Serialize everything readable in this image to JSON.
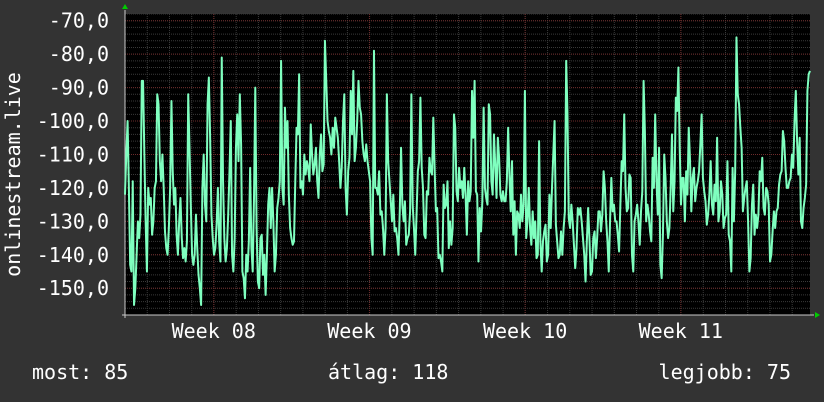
{
  "colors": {
    "background": "#333333",
    "plot_bg": "#000000",
    "line": "#7fffbf",
    "grid_major": "#6e2b2b",
    "grid_minor": "#3a3a3a",
    "axis": "#c8c8c8",
    "arrow": "#00cc00",
    "text": "#ffffff"
  },
  "chart_data": {
    "type": "line",
    "ylabel": "onlinestream.live",
    "ylim": [
      -158,
      -68
    ],
    "yticks": [
      -70,
      -80,
      -90,
      -100,
      -110,
      -120,
      -130,
      -140,
      -150
    ],
    "ytick_labels": [
      "-70,0",
      "-80,0",
      "-90,0",
      "-100,0",
      "-110,0",
      "-120,0",
      "-130,0",
      "-140,0",
      "-150,0"
    ],
    "xlim": [
      0,
      4.4
    ],
    "xticks": [
      0.57,
      1.57,
      2.57,
      3.57
    ],
    "xtick_labels": [
      "Week 08",
      "Week 09",
      "Week 10",
      "Week 11"
    ],
    "grid": true,
    "series": [
      {
        "values": [
          -122,
          -110,
          -100,
          -120,
          -143,
          -145,
          -118,
          -155,
          -150,
          -140,
          -130,
          -135,
          -128,
          -88,
          -88,
          -110,
          -130,
          -145,
          -120,
          -125,
          -123,
          -134,
          -130,
          -120,
          -118,
          -92,
          -95,
          -112,
          -118,
          -110,
          -120,
          -133,
          -138,
          -140,
          -132,
          -120,
          -94,
          -115,
          -125,
          -120,
          -134,
          -140,
          -130,
          -123,
          -135,
          -141,
          -138,
          -142,
          -136,
          -92,
          -108,
          -125,
          -140,
          -143,
          -140,
          -128,
          -138,
          -146,
          -150,
          -155,
          -120,
          -110,
          -125,
          -130,
          -95,
          -87,
          -105,
          -128,
          -135,
          -140,
          -138,
          -131,
          -120,
          -136,
          -142,
          -81,
          -118,
          -135,
          -142,
          -138,
          -128,
          -115,
          -100,
          -140,
          -145,
          -135,
          -108,
          -98,
          -112,
          -92,
          -107,
          -145,
          -147,
          -153,
          -140,
          -145,
          -136,
          -114,
          -138,
          -145,
          -123,
          -90,
          -132,
          -148,
          -150,
          -135,
          -134,
          -146,
          -140,
          -152,
          -140,
          -125,
          -120,
          -132,
          -120,
          -130,
          -145,
          -140,
          -126,
          -123,
          -118,
          -82,
          -120,
          -125,
          -96,
          -108,
          -100,
          -122,
          -132,
          -135,
          -137,
          -136,
          -118,
          -102,
          -104,
          -86,
          -120,
          -118,
          -122,
          -110,
          -116,
          -112,
          -114,
          -118,
          -101,
          -110,
          -116,
          -113,
          -108,
          -118,
          -123,
          -110,
          -104,
          -115,
          -113,
          -76,
          -88,
          -100,
          -103,
          -105,
          -110,
          -102,
          -108,
          -99,
          -102,
          -105,
          -112,
          -120,
          -114,
          -100,
          -92,
          -120,
          -128,
          -115,
          -111,
          -91,
          -104,
          -85,
          -112,
          -108,
          -100,
          -88,
          -96,
          -98,
          -106,
          -110,
          -112,
          -107,
          -112,
          -115,
          -118,
          -135,
          -140,
          -79,
          -120,
          -120,
          -122,
          -115,
          -128,
          -127,
          -132,
          -140,
          -132,
          -92,
          -112,
          -118,
          -124,
          -130,
          -122,
          -133,
          -132,
          -135,
          -140,
          -127,
          -108,
          -125,
          -130,
          -124,
          -137,
          -135,
          -134,
          -127,
          -92,
          -125,
          -132,
          -140,
          -128,
          -115,
          -112,
          -93,
          -114,
          -120,
          -134,
          -135,
          -121,
          -122,
          -111,
          -115,
          -116,
          -99,
          -114,
          -127,
          -126,
          -141,
          -140,
          -142,
          -145,
          -119,
          -126,
          -125,
          -118,
          -138,
          -130,
          -137,
          -132,
          -98,
          -102,
          -121,
          -124,
          -114,
          -120,
          -118,
          -123,
          -114,
          -122,
          -134,
          -118,
          -124,
          -121,
          -91,
          -105,
          -88,
          -121,
          -122,
          -142,
          -126,
          -133,
          -124,
          -96,
          -120,
          -123,
          -125,
          -95,
          -98,
          -118,
          -122,
          -104,
          -113,
          -123,
          -105,
          -111,
          -122,
          -124,
          -121,
          -124,
          -124,
          -118,
          -102,
          -116,
          -127,
          -112,
          -134,
          -124,
          -140,
          -127,
          -128,
          -132,
          -122,
          -130,
          -125,
          -91,
          -135,
          -130,
          -120,
          -132,
          -137,
          -127,
          -135,
          -130,
          -141,
          -140,
          -106,
          -136,
          -145,
          -136,
          -133,
          -131,
          -142,
          -140,
          -122,
          -132,
          -120,
          -110,
          -100,
          -131,
          -136,
          -141,
          -140,
          -133,
          -140,
          -132,
          -127,
          -82,
          -98,
          -129,
          -132,
          -125,
          -130,
          -137,
          -144,
          -138,
          -126,
          -128,
          -126,
          -130,
          -135,
          -140,
          -148,
          -136,
          -126,
          -135,
          -146,
          -145,
          -135,
          -133,
          -141,
          -135,
          -127,
          -127,
          -133,
          -128,
          -115,
          -120,
          -130,
          -136,
          -145,
          -130,
          -117,
          -127,
          -125,
          -130,
          -130,
          -134,
          -139,
          -125,
          -112,
          -115,
          -98,
          -120,
          -127,
          -126,
          -116,
          -117,
          -140,
          -145,
          -130,
          -128,
          -125,
          -130,
          -137,
          -127,
          -121,
          -88,
          -103,
          -130,
          -125,
          -128,
          -133,
          -136,
          -111,
          -120,
          -98,
          -118,
          -128,
          -108,
          -143,
          -147,
          -134,
          -110,
          -117,
          -130,
          -135,
          -132,
          -120,
          -104,
          -127,
          -118,
          -93,
          -97,
          -84,
          -108,
          -125,
          -117,
          -117,
          -130,
          -115,
          -122,
          -102,
          -112,
          -127,
          -117,
          -114,
          -124,
          -120,
          -118,
          -115,
          -107,
          -98,
          -117,
          -121,
          -124,
          -131,
          -128,
          -122,
          -112,
          -125,
          -128,
          -119,
          -124,
          -105,
          -130,
          -127,
          -118,
          -122,
          -132,
          -129,
          -128,
          -112,
          -134,
          -136,
          -145,
          -114,
          -130,
          -115,
          -75,
          -92,
          -95,
          -102,
          -108,
          -127,
          -123,
          -120,
          -118,
          -130,
          -145,
          -141,
          -125,
          -119,
          -134,
          -128,
          -132,
          -128,
          -115,
          -118,
          -111,
          -126,
          -128,
          -120,
          -121,
          -125,
          -142,
          -140,
          -133,
          -127,
          -132,
          -127,
          -126,
          -119,
          -116,
          -115,
          -103,
          -106,
          -114,
          -120,
          -120,
          -118,
          -117,
          -110,
          -114,
          -100,
          -91,
          -106,
          -116,
          -105,
          -130,
          -132,
          -126,
          -123,
          -119,
          -91,
          -86,
          -85
        ]
      }
    ]
  },
  "footer": {
    "now": "most: 85",
    "avg": "átlag: 118",
    "best": "legjobb: 75"
  }
}
